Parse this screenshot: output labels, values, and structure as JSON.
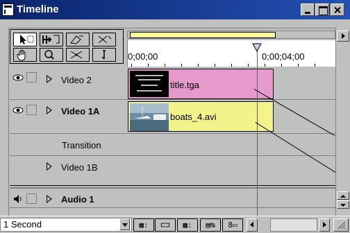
{
  "window": {
    "title": "Timeline"
  },
  "tools": [
    {
      "name": "selection-tool",
      "glyph": "▲",
      "selected": true
    },
    {
      "name": "range-select-tool",
      "glyph": "⬚",
      "selected": false
    },
    {
      "name": "track-select-tool",
      "glyph": "⇉",
      "selected": false
    },
    {
      "name": "cross-fade-tool",
      "glyph": "⤡",
      "selected": false
    },
    {
      "name": "hand-tool",
      "glyph": "✋",
      "selected": false
    },
    {
      "name": "zoom-tool",
      "glyph": "🔍",
      "selected": false
    },
    {
      "name": "razor-tool",
      "glyph": "✂",
      "selected": false
    },
    {
      "name": "in-out-tool",
      "glyph": "{",
      "selected": false
    }
  ],
  "ruler": {
    "start_timecode": "0;00;00",
    "mark_timecode": "0;00;04;00"
  },
  "tracks": [
    {
      "name": "video-2",
      "label": "Video 2",
      "bold": false,
      "clip": {
        "label": "title.tga",
        "color": "#e59acb"
      }
    },
    {
      "name": "video-1a",
      "label": "Video 1A",
      "bold": true,
      "clip": {
        "label": "boats_4.avi",
        "color": "#f3f38c"
      }
    },
    {
      "name": "transition",
      "label": "Transition"
    },
    {
      "name": "video-1b",
      "label": "Video 1B",
      "bold": false
    },
    {
      "name": "audio-1",
      "label": "Audio 1",
      "bold": true
    }
  ],
  "bottom": {
    "duration": "1 Second"
  },
  "colors": {
    "titlebar": "#0a246a",
    "workarea": "#ffff99",
    "title_clip": "#e59acb",
    "video_clip": "#f3f38c"
  }
}
